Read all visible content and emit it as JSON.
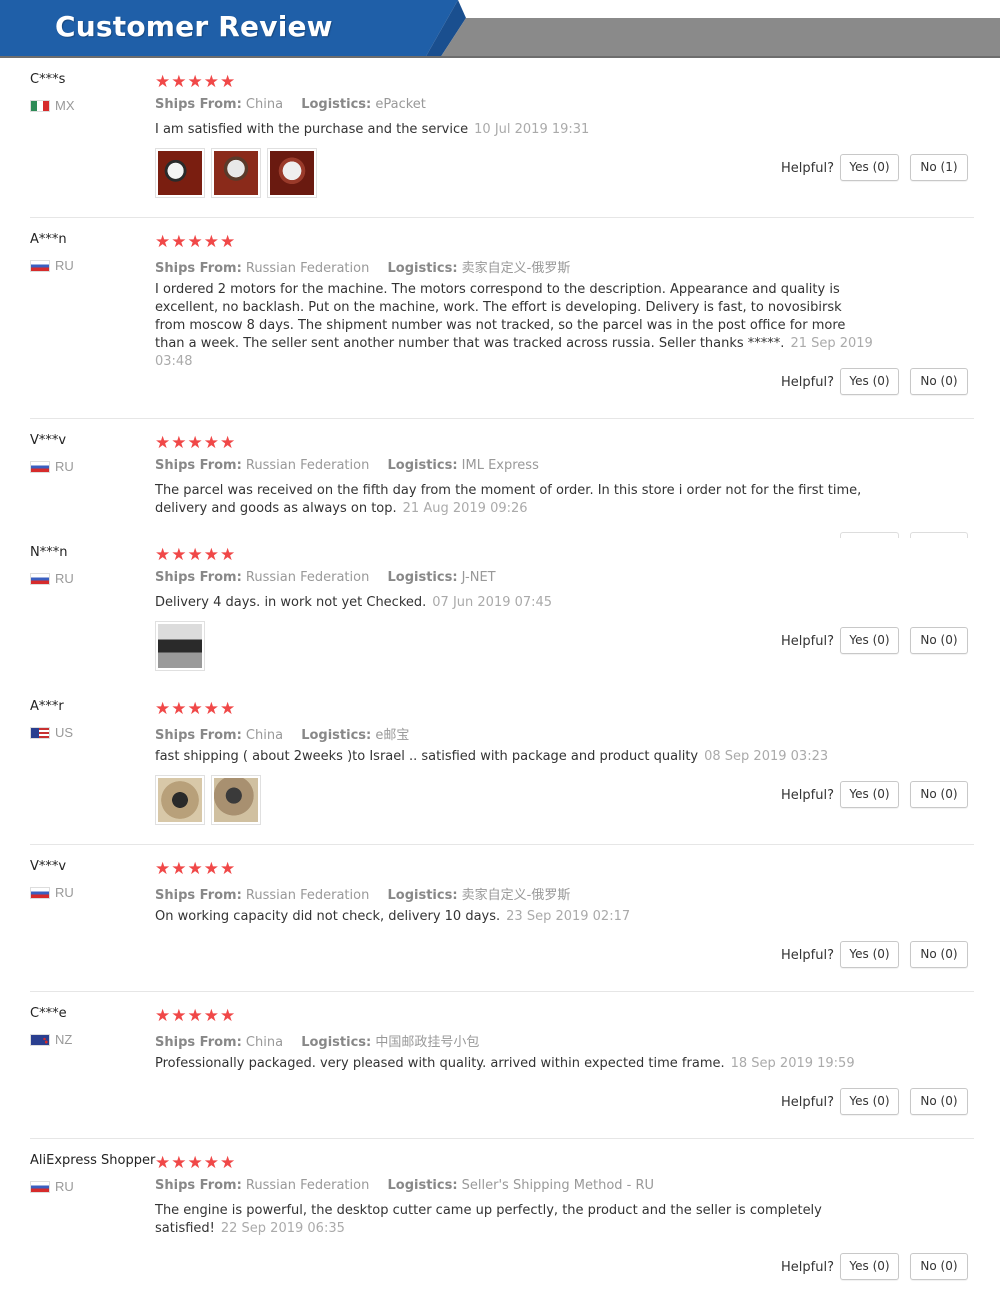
{
  "header": {
    "title": "Customer Review"
  },
  "colors": {
    "header_blue": "#1f5fa8",
    "header_gray": "#8a8a8a",
    "star_red": "#f04848"
  },
  "helpful_label": "Helpful?",
  "reviews": [
    {
      "user": "C***s",
      "country": "MX",
      "flag": "mx-flag-icon",
      "stars": "★★★★★",
      "ships_label": "Ships From:",
      "ships_from": "China",
      "logistics_label": "Logistics:",
      "logistics": "ePacket",
      "text": "I am satisfied with the purchase and the service",
      "date": "10 Jul 2019 19:31",
      "yes": "Yes (0)",
      "no": "No (1)"
    },
    {
      "user": "A***n",
      "country": "RU",
      "flag": "ru-flag-icon",
      "stars": "★★★★★",
      "ships_label": "Ships From:",
      "ships_from": "Russian Federation",
      "logistics_label": "Logistics:",
      "logistics": "卖家自定义-俄罗斯",
      "text": "I ordered 2 motors for the machine. The motors correspond to the description. Appearance and quality is excellent, no backlash. Put on the machine, work. The effort is developing. Delivery is fast, to novosibirsk from moscow 8 days. The shipment number was not tracked, so the parcel was in the post office for more than a week. The seller sent another number that was tracked across russia. Seller thanks *****.",
      "date": "21 Sep 2019 03:48",
      "yes": "Yes (0)",
      "no": "No (0)"
    },
    {
      "user": "V***v",
      "country": "RU",
      "flag": "ru-flag-icon",
      "stars": "★★★★★",
      "ships_label": "Ships From:",
      "ships_from": "Russian Federation",
      "logistics_label": "Logistics:",
      "logistics": "IML Express",
      "text": "The parcel was received on the fifth day from the moment of order. In this store i order not for the first time, delivery and goods as always on top.",
      "date": "21 Aug 2019 09:26"
    },
    {
      "user": "N***n",
      "country": "RU",
      "flag": "ru-flag-icon",
      "stars": "★★★★★",
      "ships_label": "Ships From:",
      "ships_from": "Russian Federation",
      "logistics_label": "Logistics:",
      "logistics": "J-NET",
      "text": "Delivery 4 days. in work not yet Checked.",
      "date": "07 Jun 2019 07:45",
      "yes": "Yes (0)",
      "no": "No (0)"
    },
    {
      "user": "A***r",
      "country": "US",
      "flag": "us-flag-icon",
      "stars": "★★★★★",
      "ships_label": "Ships From:",
      "ships_from": "China",
      "logistics_label": "Logistics:",
      "logistics": "e邮宝",
      "text": "fast shipping ( about 2weeks )to Israel .. satisfied with package and product quality",
      "date": "08 Sep 2019 03:23",
      "yes": "Yes (0)",
      "no": "No (0)"
    },
    {
      "user": "V***v",
      "country": "RU",
      "flag": "ru-flag-icon",
      "stars": "★★★★★",
      "ships_label": "Ships From:",
      "ships_from": "Russian Federation",
      "logistics_label": "Logistics:",
      "logistics": "卖家自定义-俄罗斯",
      "text": "On working capacity did not check, delivery 10 days.",
      "date": "23 Sep 2019 02:17",
      "yes": "Yes (0)",
      "no": "No (0)"
    },
    {
      "user": "C***e",
      "country": "NZ",
      "flag": "nz-flag-icon",
      "stars": "★★★★★",
      "ships_label": "Ships From:",
      "ships_from": "China",
      "logistics_label": "Logistics:",
      "logistics": "中国邮政挂号小包",
      "text": "Professionally packaged. very pleased with quality. arrived within expected time frame.",
      "date": "18 Sep 2019 19:59",
      "yes": "Yes (0)",
      "no": "No (0)"
    },
    {
      "user": "AliExpress Shopper",
      "country": "RU",
      "flag": "ru-flag-icon",
      "stars": "★★★★★",
      "ships_label": "Ships From:",
      "ships_from": "Russian Federation",
      "logistics_label": "Logistics:",
      "logistics": "Seller's Shipping Method - RU",
      "text": "The engine is powerful, the desktop cutter came up perfectly, the product and the seller is completely satisfied!",
      "date": "22 Sep 2019 06:35",
      "yes": "Yes (0)",
      "no": "No (0)"
    }
  ]
}
